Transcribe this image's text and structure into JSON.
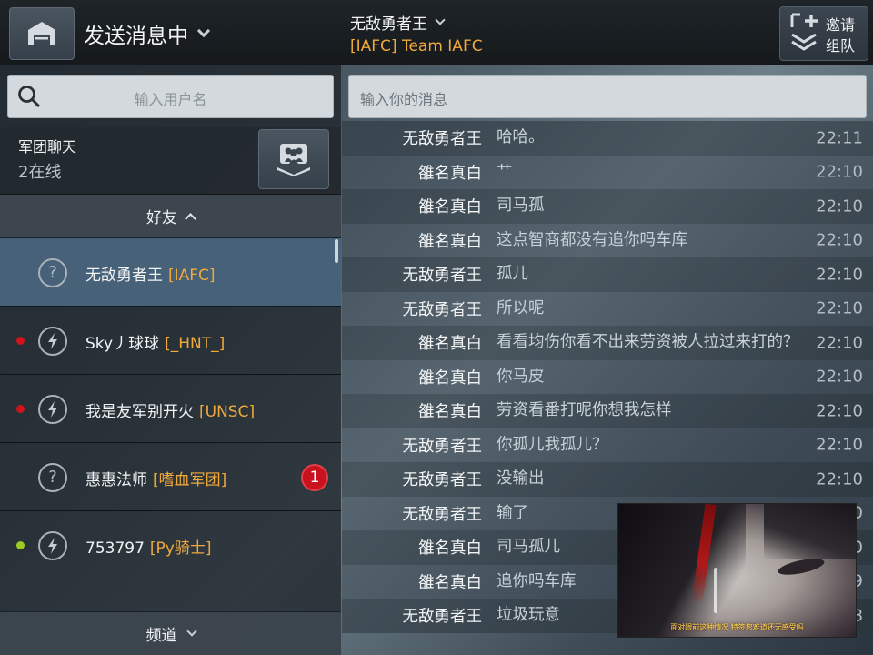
{
  "header": {
    "status_label": "发送消息中",
    "chat_name": "无敌勇者王",
    "chat_team": "[IAFC] Team IAFC",
    "invite_label": "邀请组队"
  },
  "sidebar": {
    "search_placeholder": "输入用户名",
    "legion": {
      "title": "军团聊天",
      "online": "2在线"
    },
    "friends_header": "好友",
    "friends": [
      {
        "name": "无敌勇者王",
        "tag": "[IAFC]",
        "status": "unknown",
        "dot": "",
        "badge": "",
        "selected": true
      },
      {
        "name": "Sky丿球球",
        "tag": "[_HNT_]",
        "status": "in-game",
        "dot": "#d0121b",
        "badge": "",
        "selected": false
      },
      {
        "name": "我是友军别开火",
        "tag": "[UNSC]",
        "status": "in-game",
        "dot": "#d0121b",
        "badge": "",
        "selected": false
      },
      {
        "name": "惠惠法师",
        "tag": "[嗜血军团]",
        "status": "unknown",
        "dot": "",
        "badge": "1",
        "selected": false
      },
      {
        "name": "753797",
        "tag": "[Py骑士]",
        "status": "in-game",
        "dot": "#9ccc22",
        "badge": "",
        "selected": false
      }
    ],
    "channel_label": "频道"
  },
  "chat": {
    "input_placeholder": "输入你的消息",
    "messages": [
      {
        "sender": "无敌勇者王",
        "text": "哈哈。",
        "time": "22:11"
      },
      {
        "sender": "雒名真白",
        "text": "艹",
        "time": "22:10"
      },
      {
        "sender": "雒名真白",
        "text": "司马孤",
        "time": "22:10"
      },
      {
        "sender": "雒名真白",
        "text": "这点智商都没有追你吗车库",
        "time": "22:10"
      },
      {
        "sender": "无敌勇者王",
        "text": "孤儿",
        "time": "22:10"
      },
      {
        "sender": "无敌勇者王",
        "text": "所以呢",
        "time": "22:10"
      },
      {
        "sender": "雒名真白",
        "text": "看看均伤你看不出来劳资被人拉过来打的？",
        "time": "22:10"
      },
      {
        "sender": "雒名真白",
        "text": "你马皮",
        "time": "22:10"
      },
      {
        "sender": "雒名真白",
        "text": "劳资看番打呢你想我怎样",
        "time": "22:10"
      },
      {
        "sender": "无敌勇者王",
        "text": "你孤儿我孤儿？",
        "time": "22:10"
      },
      {
        "sender": "无敌勇者王",
        "text": "没输出",
        "time": "22:10"
      },
      {
        "sender": "无敌勇者王",
        "text": "输了",
        "time": "22:10"
      },
      {
        "sender": "雒名真白",
        "text": "司马孤儿",
        "time": "22:10"
      },
      {
        "sender": "雒名真白",
        "text": "追你吗车库",
        "time": "22:09"
      },
      {
        "sender": "无敌勇者王",
        "text": "垃圾玩意",
        "time": "22:08"
      }
    ]
  },
  "video_overlay": {
    "subtitle": "面对眼前这种情况 特签您难道还无感受吗"
  },
  "colors": {
    "accent": "#f0a93b",
    "selected_row": "#4c6a84",
    "badge": "#c8121e"
  }
}
